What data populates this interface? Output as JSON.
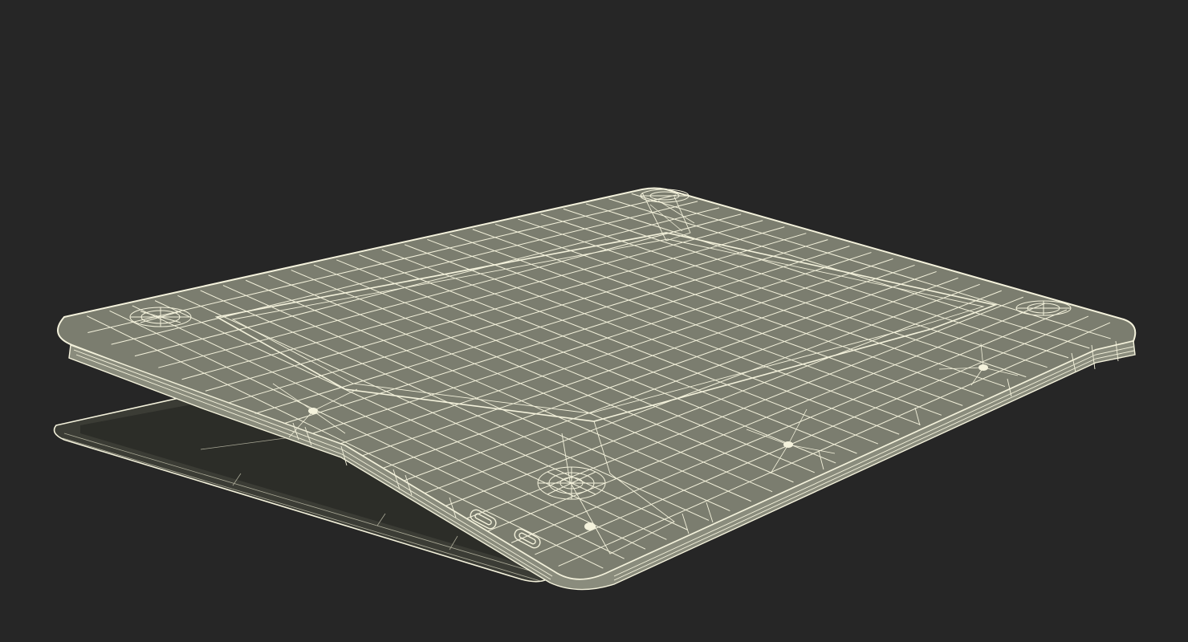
{
  "scene": {
    "subject": "laptop-wireframe-render",
    "colors": {
      "background": "#262626",
      "shell_fill": "#7b7d6f",
      "base_fill": "#3b3c35",
      "wire": "#f4f2dc",
      "wire_dim": "#c9c7b2"
    },
    "features": {
      "rubber_feet": 4,
      "screw_points": 4,
      "side_ports": 2
    }
  }
}
